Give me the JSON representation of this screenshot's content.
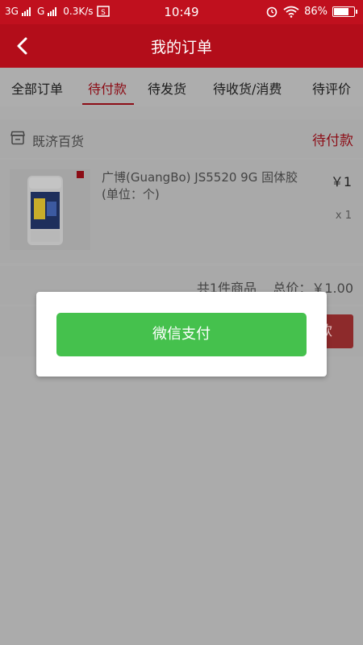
{
  "status_bar": {
    "network1": "3G",
    "network2": "G",
    "speed": "0.3K/s",
    "time": "10:49",
    "battery": "86%",
    "battery_level": 0.86,
    "icons": [
      "signal-icon",
      "signal-icon",
      "screenshot-icon",
      "alarm-icon",
      "wifi-icon",
      "battery-icon"
    ]
  },
  "header": {
    "title": "我的订单",
    "back_icon": "chevron-left-icon"
  },
  "tabs": [
    {
      "label": "全部订单",
      "active": false
    },
    {
      "label": "待付款",
      "active": true
    },
    {
      "label": "待发货",
      "active": false
    },
    {
      "label": "待收货/消费",
      "active": false
    },
    {
      "label": "待评价",
      "active": false
    }
  ],
  "order": {
    "shop_name": "既济百货",
    "status": "待付款",
    "product": {
      "name": "广博(GuangBo) JS5520 9G 固体胶(单位：个)",
      "price": "￥1",
      "quantity": "x 1"
    },
    "summary": "共1件商品    总价：￥1.00",
    "pay_button": "付款"
  },
  "modal": {
    "pay_option": "微信支付"
  },
  "colors": {
    "status_bar": "#c0101e",
    "header": "#b30d1a",
    "accent": "#8c0d16",
    "wechat_green": "#45c14d",
    "overlay": "#ababab"
  }
}
